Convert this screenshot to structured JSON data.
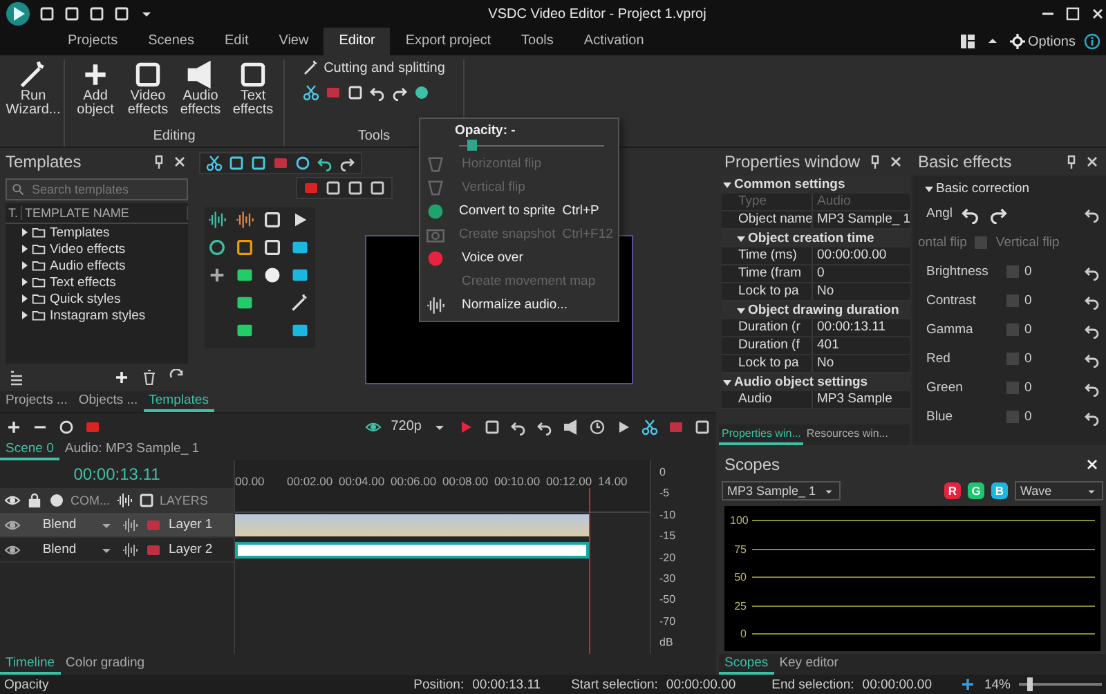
{
  "window": {
    "title": "VSDC Video Editor - Project 1.vproj"
  },
  "menu_tabs": [
    {
      "label": "Projects",
      "selected": false
    },
    {
      "label": "Scenes",
      "selected": false
    },
    {
      "label": "Edit",
      "selected": false
    },
    {
      "label": "View",
      "selected": false
    },
    {
      "label": "Editor",
      "selected": true
    },
    {
      "label": "Export project",
      "selected": false
    },
    {
      "label": "Tools",
      "selected": false
    },
    {
      "label": "Activation",
      "selected": false
    }
  ],
  "options": {
    "label": "Options"
  },
  "ribbon": {
    "run_wizard": "Run Wizard...",
    "editing": {
      "buttons": [
        "Add object",
        "Video effects",
        "Audio effects",
        "Text effects"
      ],
      "label": "Editing"
    },
    "tools": {
      "cutting": "Cutting and splitting",
      "label": "Tools"
    }
  },
  "templates_panel": {
    "title": "Templates",
    "search": {
      "placeholder": "Search templates"
    },
    "columns": [
      "T.",
      "TEMPLATE NAME"
    ],
    "tree": [
      {
        "label": "Templates",
        "expanded": false
      },
      {
        "label": "Video effects",
        "expanded": false
      },
      {
        "label": "Audio effects",
        "expanded": false
      },
      {
        "label": "Text effects",
        "expanded": false
      },
      {
        "label": "Quick styles",
        "expanded": false
      },
      {
        "label": "Instagram styles",
        "expanded": false
      }
    ],
    "tabs": [
      {
        "label": "Projects ...",
        "selected": false
      },
      {
        "label": "Objects ...",
        "selected": false
      },
      {
        "label": "Templates",
        "selected": true
      }
    ]
  },
  "opacity_menu": {
    "title": "Opacity: -",
    "level": 0.06,
    "items": [
      {
        "label": "Horizontal flip",
        "disabled": true
      },
      {
        "label": "Vertical flip",
        "disabled": true
      },
      {
        "label": "Convert to sprite",
        "shortcut": "Ctrl+P",
        "disabled": false
      },
      {
        "label": "Create snapshot",
        "shortcut": "Ctrl+F12",
        "disabled": true
      },
      {
        "label": "Voice over",
        "disabled": false
      },
      {
        "label": "Create movement map",
        "disabled": true
      },
      {
        "label": "Normalize audio...",
        "disabled": false
      }
    ]
  },
  "preview": {
    "resolution": "720p"
  },
  "properties": {
    "title": "Properties window",
    "rows": [
      {
        "kind": "section",
        "label": "Common settings"
      },
      {
        "kind": "row",
        "name": "Type",
        "value": "Audio",
        "disabled": true
      },
      {
        "kind": "row",
        "name": "Object name",
        "value": "MP3 Sample_ 1",
        "disabled": false
      },
      {
        "kind": "group",
        "label": "Object creation time"
      },
      {
        "kind": "row",
        "name": "Time (ms)",
        "value": "00:00:00.00",
        "disabled": false
      },
      {
        "kind": "row",
        "name": "Time (fram",
        "value": "0",
        "disabled": false
      },
      {
        "kind": "row",
        "name": "Lock to pa",
        "value": "No",
        "disabled": false
      },
      {
        "kind": "group",
        "label": "Object drawing duration"
      },
      {
        "kind": "row",
        "name": "Duration (r",
        "value": "00:00:13.11",
        "disabled": false
      },
      {
        "kind": "row",
        "name": "Duration (f",
        "value": "401",
        "disabled": false
      },
      {
        "kind": "row",
        "name": "Lock to pa",
        "value": "No",
        "disabled": false
      },
      {
        "kind": "section",
        "label": "Audio object settings"
      },
      {
        "kind": "row",
        "name": "Audio",
        "value": "MP3 Sample",
        "disabled": false
      }
    ],
    "tabs": [
      {
        "label": "Properties win...",
        "selected": true
      },
      {
        "label": "Resources win...",
        "selected": false
      }
    ]
  },
  "basic_effects": {
    "title": "Basic effects",
    "section": "Basic correction",
    "angle_label": "Angl",
    "horizontal_flip": "ontal flip",
    "vertical_flip": {
      "label": "Vertical flip",
      "checked": false
    },
    "rows": [
      {
        "label": "Brightness",
        "value": "0"
      },
      {
        "label": "Contrast",
        "value": "0"
      },
      {
        "label": "Gamma",
        "value": "0"
      },
      {
        "label": "Red",
        "value": "0"
      },
      {
        "label": "Green",
        "value": "0"
      },
      {
        "label": "Blue",
        "value": "0"
      }
    ]
  },
  "timeline": {
    "tabs": [
      {
        "label": "Scene 0",
        "selected": true
      },
      {
        "label": "Audio: MP3 Sample_ 1",
        "selected": false
      }
    ],
    "time": "00:00:13.11",
    "com_label": "COM...",
    "layers_label": "LAYERS",
    "ruler": [
      "00.00",
      "00:02.00",
      "00:04.00",
      "00:06.00",
      "00:08.00",
      "00:10.00",
      "00:12.00",
      "14.00"
    ],
    "layers": [
      {
        "blend": "Blend",
        "name": "Layer 1",
        "selected": true
      },
      {
        "blend": "Blend",
        "name": "Layer 2",
        "selected": false
      }
    ],
    "meter": [
      "0",
      "-5",
      "-10",
      "-15",
      "-20",
      "-30",
      "-50",
      "-70",
      "dB"
    ],
    "bottom_tabs": [
      {
        "label": "Timeline",
        "selected": true
      },
      {
        "label": "Color grading",
        "selected": false
      }
    ]
  },
  "scopes": {
    "title": "Scopes",
    "source": "MP3 Sample_ 1",
    "channels": [
      {
        "label": "R",
        "color": "#e8233f"
      },
      {
        "label": "G",
        "color": "#1fc46e"
      },
      {
        "label": "B",
        "color": "#1ab8e0"
      }
    ],
    "mode": "Wave",
    "scale": [
      "100",
      "75",
      "50",
      "25",
      "0"
    ],
    "tabs": [
      {
        "label": "Scopes",
        "selected": true
      },
      {
        "label": "Key editor",
        "selected": false
      }
    ]
  },
  "status_bar": {
    "hint": "Opacity",
    "position_label": "Position:",
    "position": "00:00:13.11",
    "start_label": "Start selection:",
    "start": "00:00:00.00",
    "end_label": "End selection:",
    "end": "00:00:00.00",
    "zoom": "14%",
    "zoom_level": {
      "level": 0.1
    }
  }
}
